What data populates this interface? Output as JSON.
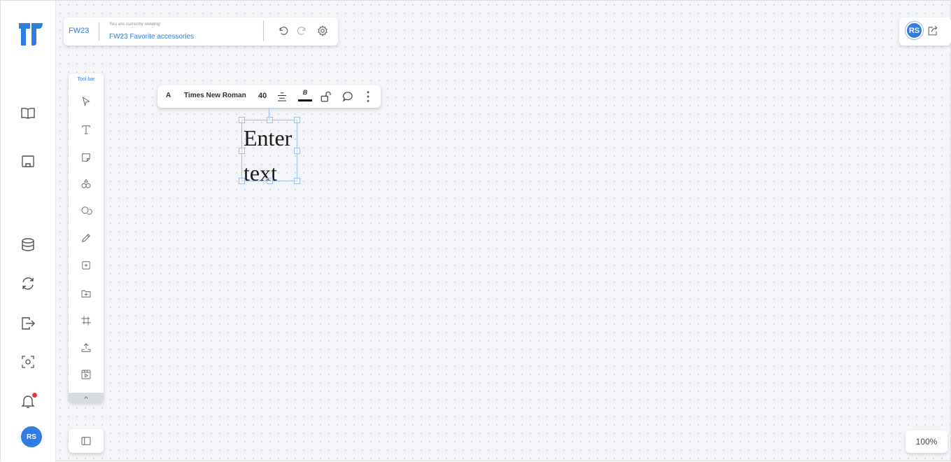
{
  "header": {
    "project_code": "FW23",
    "viewing_label": "You are currently viewing:",
    "viewing_value": "FW23 Favorite accessories"
  },
  "user": {
    "initials": "RS"
  },
  "toolbar": {
    "label": "Tool bar",
    "tools": [
      "pointer-icon",
      "text-icon",
      "sticky-note-icon",
      "shapes-icon",
      "comment-icon",
      "pencil-icon",
      "add-frame-icon",
      "add-folder-icon",
      "crop-icon",
      "upload-icon",
      "media-icon"
    ]
  },
  "format_bar": {
    "font_icon_label": "A",
    "font_name": "Times New Roman",
    "font_size": "40",
    "bold_label": "B"
  },
  "text_box": {
    "text": "Enter text"
  },
  "zoom": {
    "level": "100%"
  },
  "colors": {
    "accent": "#2f7de1",
    "notification": "#e53935",
    "canvas": "#f3f5f8"
  }
}
